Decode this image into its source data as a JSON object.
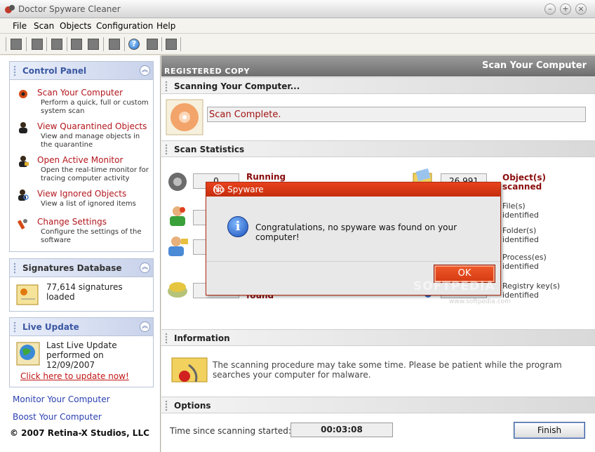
{
  "window": {
    "title": "Doctor Spyware Cleaner",
    "buttons": {
      "minimize": "–",
      "maximize": "+",
      "close": "×"
    }
  },
  "menu": [
    "File",
    "Scan",
    "Objects",
    "Configuration",
    "Help"
  ],
  "toolbar": {
    "help_glyph": "?"
  },
  "sidebar": {
    "control_panel": {
      "title": "Control Panel",
      "collapse_glyph": "︽",
      "items": [
        {
          "label": "Scan Your Computer",
          "desc": "Perform a quick, full or custom system scan",
          "icon": "eye-icon"
        },
        {
          "label": "View Quarantined Objects",
          "desc": "View and manage objects in the quarantine",
          "icon": "agent-icon"
        },
        {
          "label": "Open Active Monitor",
          "desc": "Open the real-time monitor for tracing computer activity",
          "icon": "monitor-agent-icon"
        },
        {
          "label": "View Ignored Objects",
          "desc": "View a list of ignored items",
          "icon": "magnifier-agent-icon"
        },
        {
          "label": "Change Settings",
          "desc": "Configure the settings of the software",
          "icon": "wrench-icon"
        }
      ]
    },
    "signatures": {
      "title": "Signatures Database",
      "text": "77,614 signatures loaded"
    },
    "live_update": {
      "title": "Live Update",
      "text": "Last Live Update performed on 12/09/2007",
      "link": "Click here to update now!"
    },
    "monitor_link": "Monitor Your Computer",
    "boost_link": "Boost Your Computer",
    "copyright": "© 2007 Retina-X Studios, LLC"
  },
  "main": {
    "registered": "REGISTERED COPY",
    "title": "Scan Your Computer",
    "scanning_header": "Scanning Your Computer...",
    "scan_status": "Scan Complete.",
    "stats_header": "Scan Statistics",
    "stats_left": [
      {
        "value": "0",
        "label": "Running"
      },
      {
        "value": "",
        "label": ""
      },
      {
        "value": "",
        "label": ""
      },
      {
        "value": "",
        "label": "found"
      }
    ],
    "stats_right": [
      {
        "value": "26,991",
        "label": "Object(s) scanned"
      },
      {
        "value": "",
        "label": "File(s) identified"
      },
      {
        "value": "",
        "label": "Folder(s) identified"
      },
      {
        "value": "",
        "label": "Process(es) identified"
      },
      {
        "value": "",
        "label": "Registry key(s) identified"
      }
    ],
    "info_header": "Information",
    "info_text": "The scanning procedure may take some time. Please be patient while the program searches your computer for malware.",
    "options_header": "Options",
    "elapsed_label": "Time since scanning started:",
    "elapsed_value": "00:03:08",
    "finish_label": "Finish"
  },
  "dialog": {
    "title": "No Spyware",
    "close_glyph": "×",
    "icon_glyph": "i",
    "message": "Congratulations, no spyware was found on your computer!",
    "ok_label": "OK"
  },
  "watermark": {
    "text": "SOFTPEDIA",
    "url": "www.softpedia.com"
  }
}
